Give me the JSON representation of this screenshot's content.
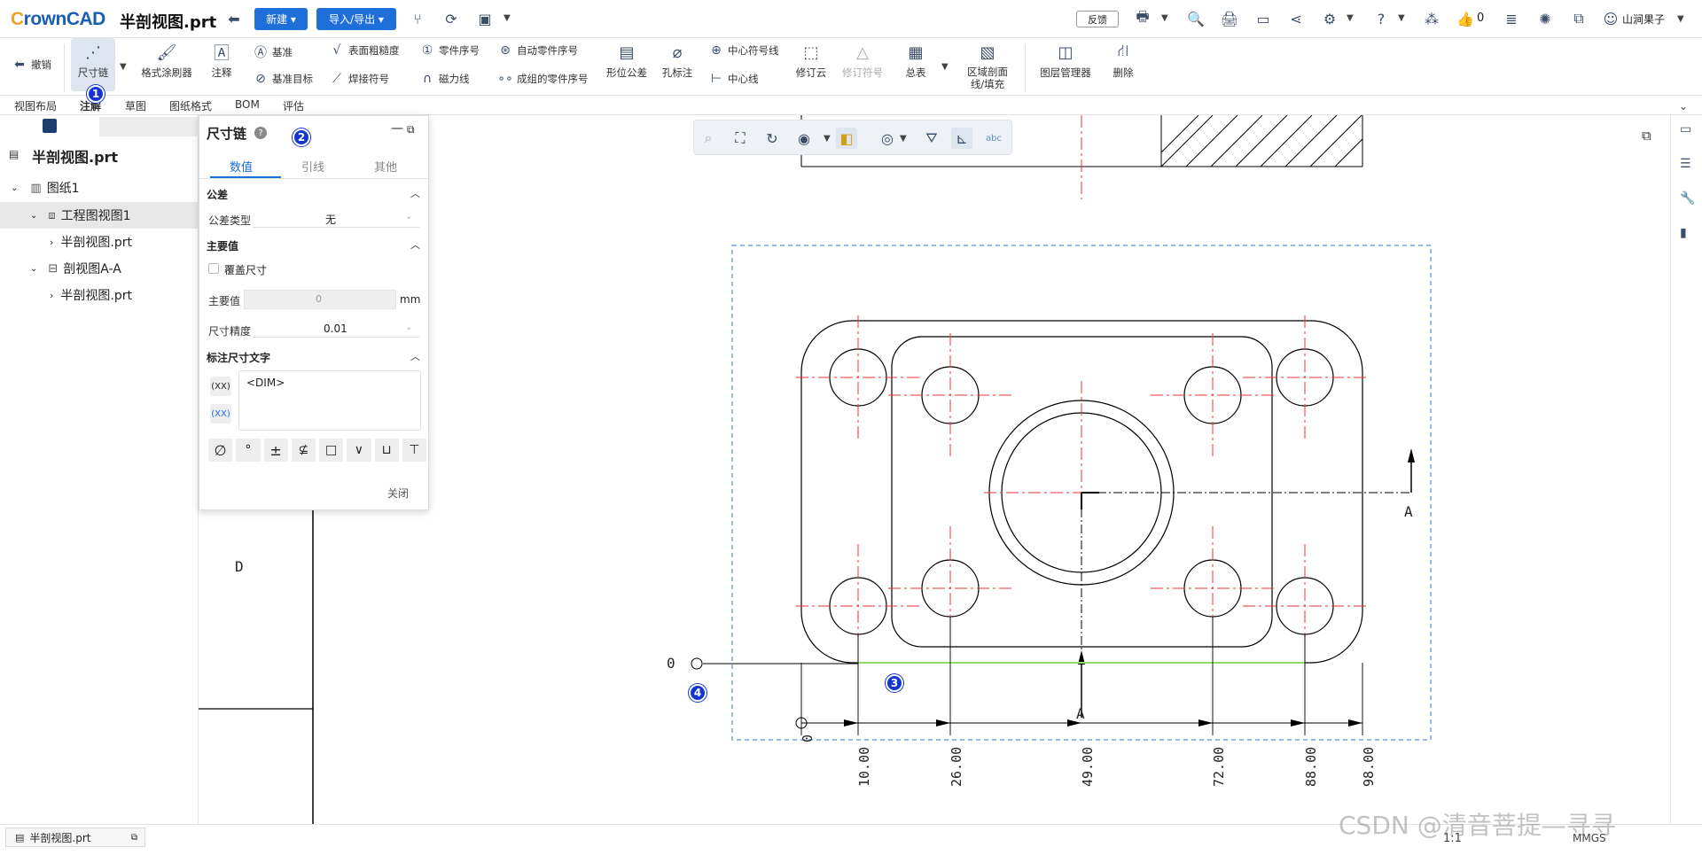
{
  "app": {
    "logo": "CrownCAD",
    "document_title": "半剖视图.prt"
  },
  "topbar": {
    "new_label": "新建",
    "import_export_label": "导入/导出",
    "feedback_label": "反馈",
    "like_count": "0",
    "user_name": "山涧果子"
  },
  "ribbon": {
    "undo": "撤销",
    "dim_chain": "尺寸链",
    "format_brush": "格式涂刷器",
    "annotation": "注释",
    "datum": "基准",
    "datum_target": "基准目标",
    "surface_roughness": "表面粗糙度",
    "weld_symbol": "焊接符号",
    "part_balloon": "零件序号",
    "magnetic_line": "磁力线",
    "auto_balloon": "自动零件序号",
    "stacked_balloon": "成组的零件序号",
    "geo_tolerance": "形位公差",
    "hole_callout": "孔标注",
    "center_mark_line": "中心符号线",
    "centerline": "中心线",
    "revision_cloud": "修订云",
    "revision_symbol": "修订符号",
    "summary_table": "总表",
    "area_hatch": "区域剖面线/填充",
    "layer_manager": "图层管理器",
    "delete": "删除"
  },
  "tabs": [
    "视图布局",
    "注解",
    "草图",
    "图纸格式",
    "BOM",
    "评估"
  ],
  "tree": {
    "root": "半剖视图.prt",
    "items": [
      {
        "label": "图纸1"
      },
      {
        "label": "工程图视图1"
      },
      {
        "label": "半剖视图.prt"
      },
      {
        "label": "剖视图A-A"
      },
      {
        "label": "半剖视图.prt"
      }
    ]
  },
  "dialog": {
    "title": "尺寸链",
    "tabs": [
      "数值",
      "引线",
      "其他"
    ],
    "tolerance_section": "公差",
    "tolerance_type_label": "公差类型",
    "tolerance_type_value": "无",
    "primary_section": "主要值",
    "override_label": "覆盖尺寸",
    "primary_value_label": "主要值",
    "primary_value": "0",
    "unit": "mm",
    "precision_label": "尺寸精度",
    "precision_value": "0.01",
    "dim_text_section": "标注尺寸文字",
    "dim_text": "<DIM>",
    "close_label": "关闭"
  },
  "badges": [
    "1",
    "2",
    "3",
    "4"
  ],
  "drawing": {
    "section_letter": "A",
    "section_letter_bottom": "A",
    "zone_letter": "D",
    "origin_label": "0",
    "dims": [
      "0",
      "10.00",
      "26.00",
      "49.00",
      "72.00",
      "88.00",
      "98.00"
    ]
  },
  "bottom": {
    "doc_tab": "半剖视图.prt",
    "scale": "1:1",
    "units": "MMGS",
    "watermark": "CSDN @清音菩提—寻寻"
  }
}
